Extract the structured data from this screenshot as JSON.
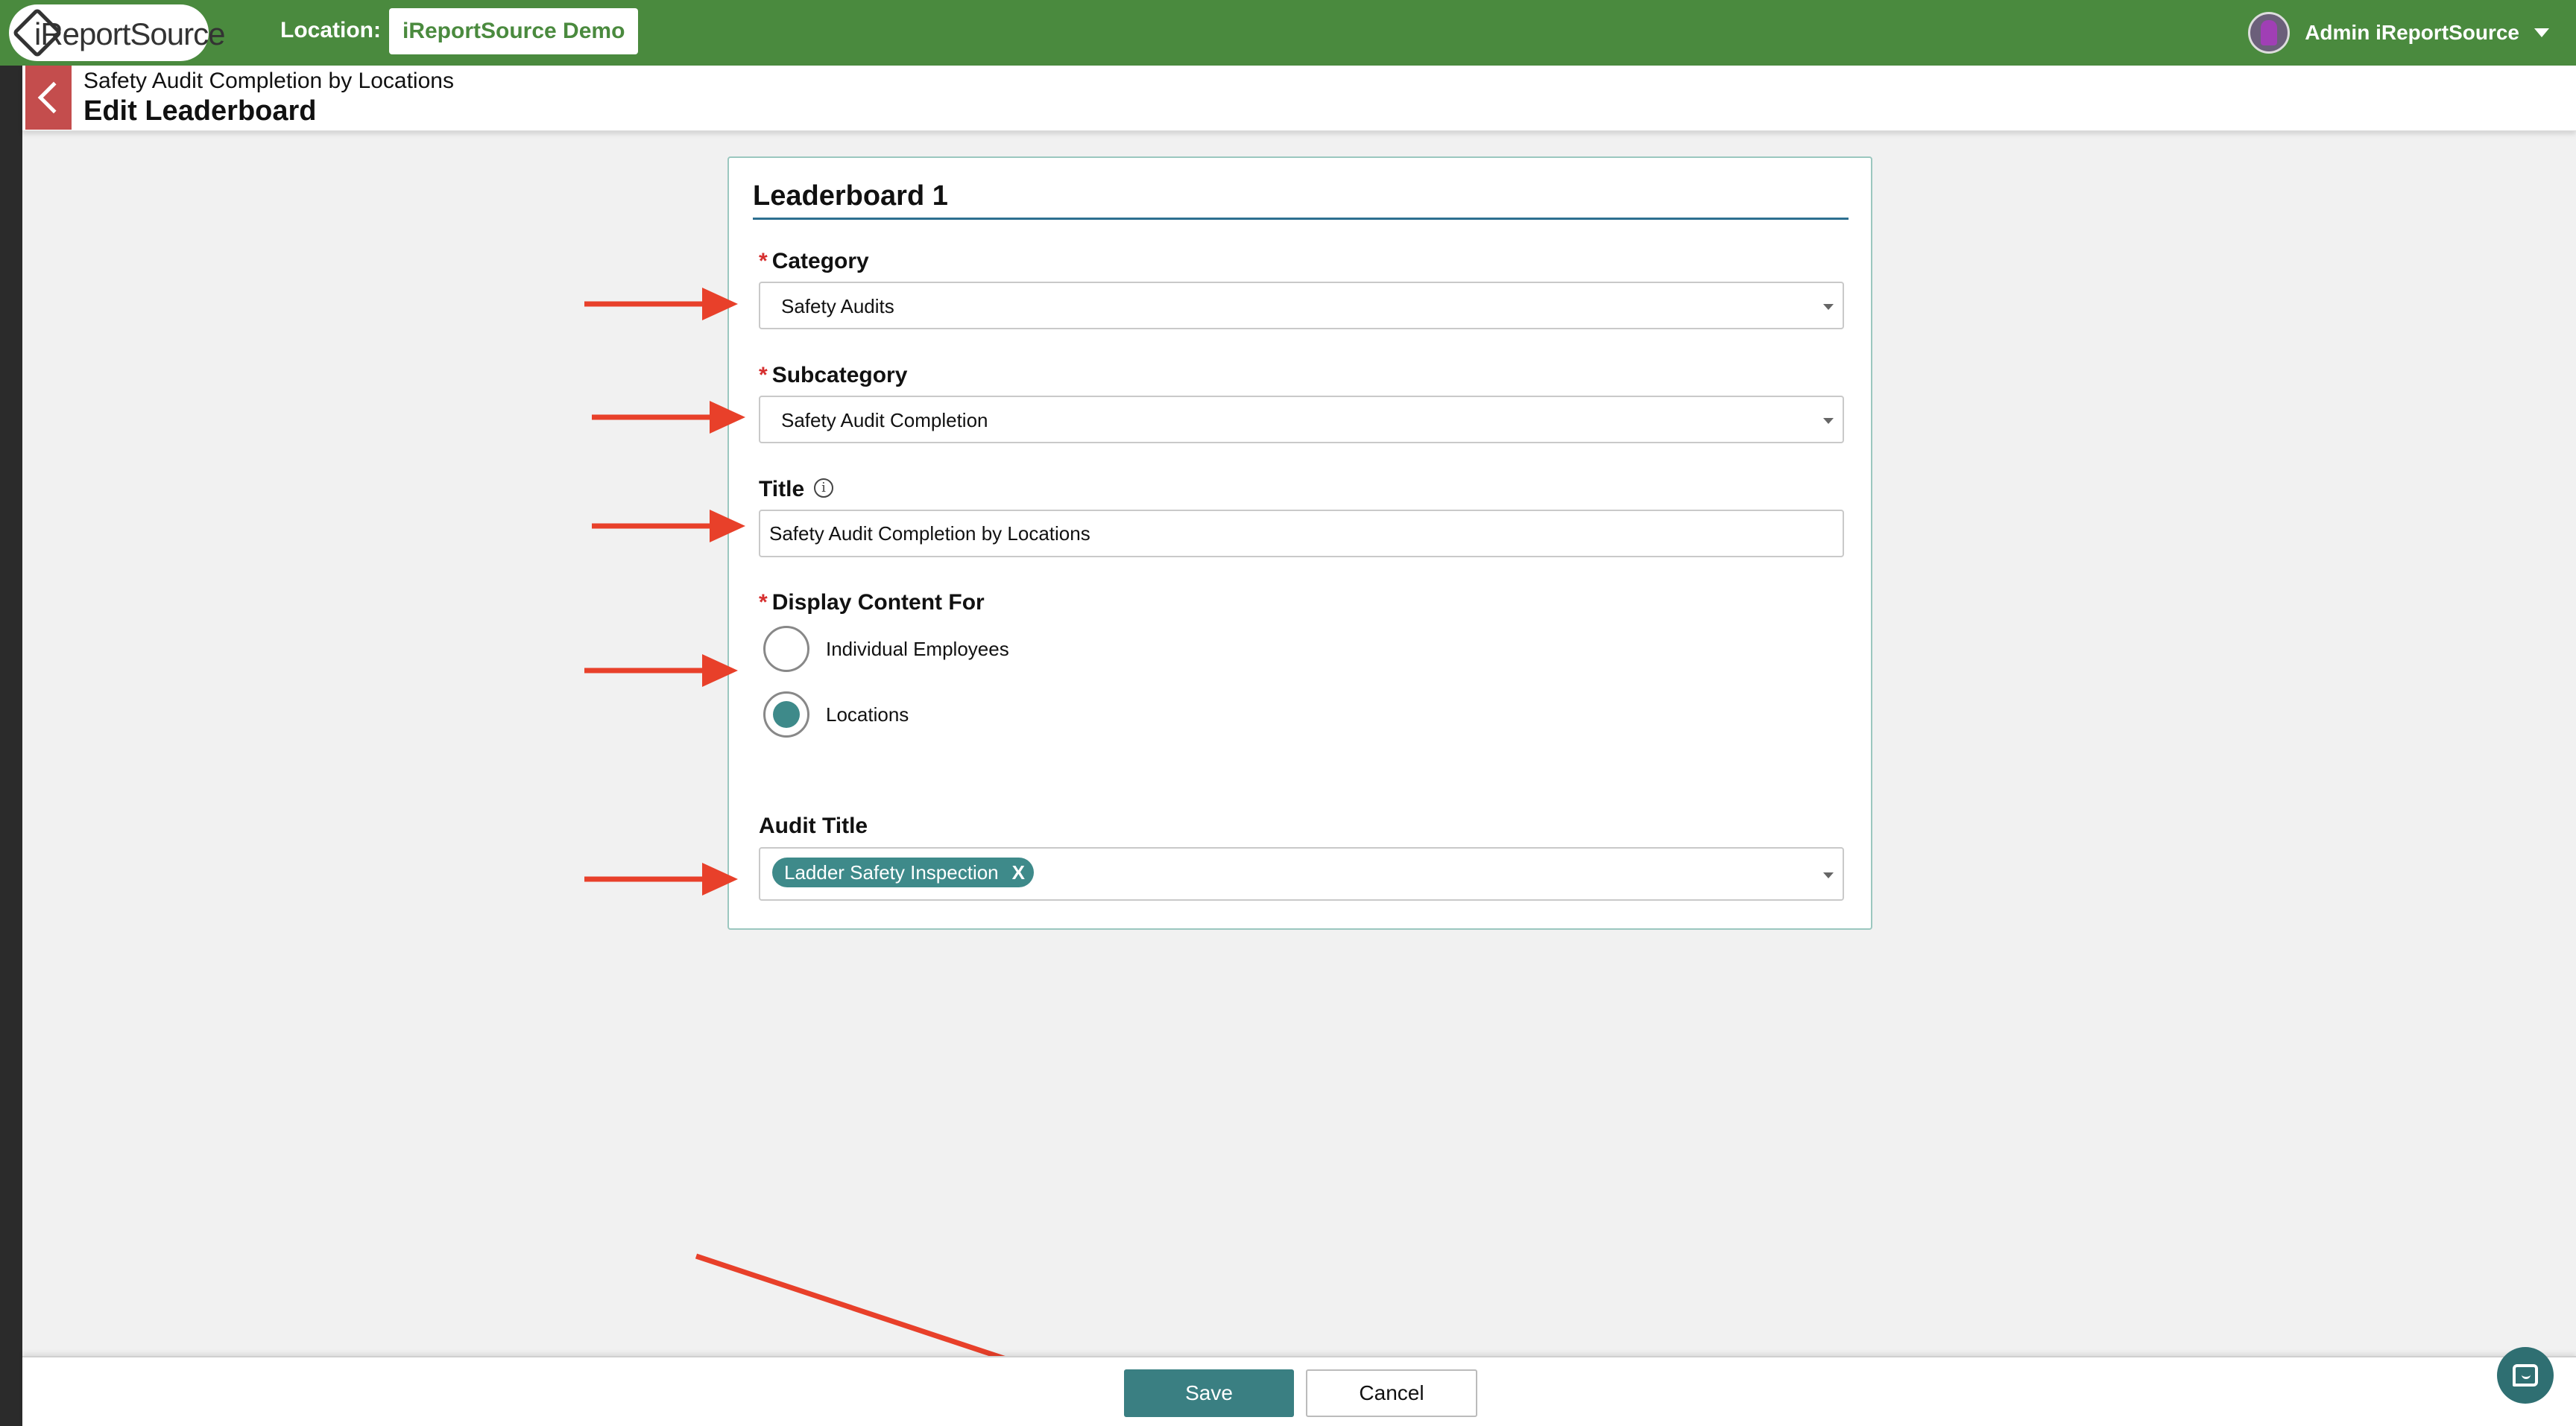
{
  "topbar": {
    "logo_text": "iReportSource",
    "location_label": "Location:",
    "location_value": "iReportSource Demo",
    "user_name": "Admin iReportSource"
  },
  "subheader": {
    "breadcrumb": "Safety Audit Completion by Locations",
    "page_title": "Edit Leaderboard"
  },
  "form": {
    "card_title": "Leaderboard 1",
    "required_mark": "*",
    "category": {
      "label": "Category",
      "value": "Safety Audits"
    },
    "subcategory": {
      "label": "Subcategory",
      "value": "Safety Audit Completion"
    },
    "title": {
      "label": "Title",
      "value": "Safety Audit Completion by Locations",
      "info_glyph": "i"
    },
    "display_content_for": {
      "label": "Display Content For",
      "options": [
        {
          "label": "Individual Employees",
          "checked": false
        },
        {
          "label": "Locations",
          "checked": true
        }
      ]
    },
    "audit_title": {
      "label": "Audit Title",
      "selected_tags": [
        {
          "label": "Ladder Safety Inspection",
          "remove": "X"
        }
      ]
    }
  },
  "footer": {
    "save_label": "Save",
    "cancel_label": "Cancel"
  },
  "colors": {
    "topbar": "#4a8a3e",
    "accent_teal": "#3e8a8a",
    "back_button": "#c44d4d",
    "required": "#d62f2f",
    "annotation_arrow": "#e8402a"
  }
}
